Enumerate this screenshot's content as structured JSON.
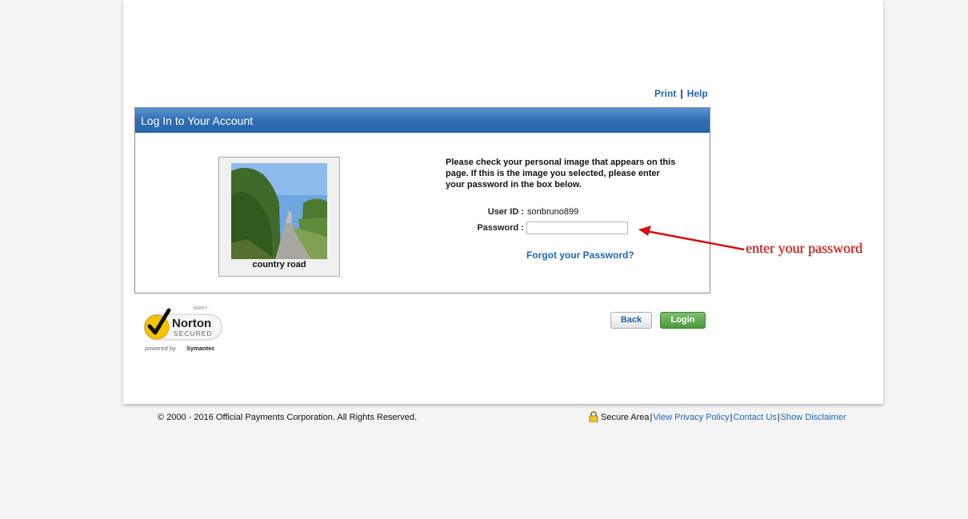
{
  "toplinks": {
    "print": "Print",
    "separator": "|",
    "help": "Help"
  },
  "panel": {
    "title": "Log In to Your Account",
    "image_caption": "country road",
    "instructions": "Please check your personal image that appears on this page. If this is the image you selected, please enter your password in the box below.",
    "userid_label": "User ID :",
    "userid_value": "sonbruno899",
    "password_label": "Password :",
    "password_value": "",
    "forgot_link": "Forgot your Password?"
  },
  "badge": {
    "verify": "VERIFY→",
    "name": "Norton",
    "secured": "SECURED",
    "powered": "powered by",
    "symantec": "Symantec"
  },
  "buttons": {
    "back": "Back",
    "login": "Login"
  },
  "annotation": {
    "text": "enter your password",
    "color": "#d21212"
  },
  "footer": {
    "copyright": "© 2000 - 2016 Official Payments Corporation. All Rights Reserved.",
    "secure_area": "Secure Area",
    "privacy": "View Privacy Policy",
    "contact": "Contact Us",
    "disclaimer": "Show Disclaimer",
    "separator": "|"
  },
  "colors": {
    "link": "#1f66b1",
    "header": "#2f6fb2",
    "login_button": "#4a9a3c"
  },
  "icons": {
    "lock": "lock-icon",
    "norton": "norton-check-icon"
  }
}
